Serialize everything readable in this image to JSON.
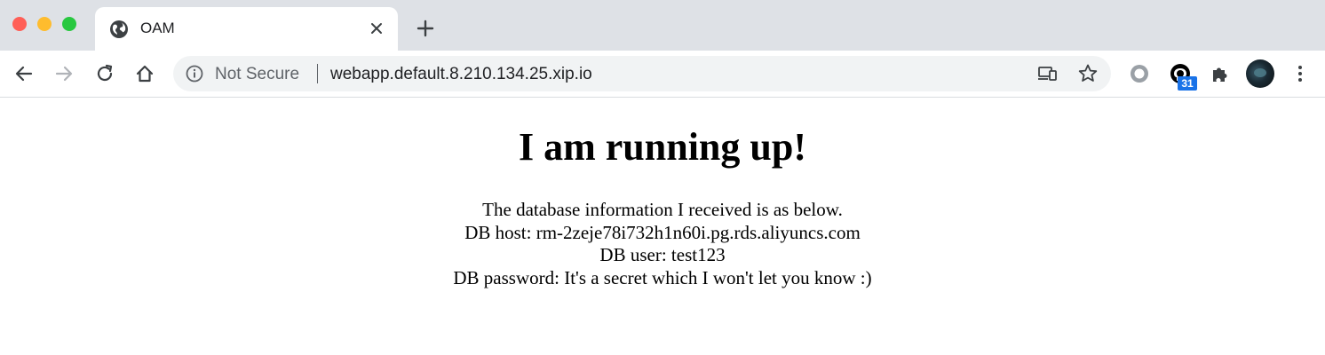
{
  "window": {
    "traffic_lights": [
      "close",
      "minimize",
      "maximize"
    ]
  },
  "tabs": [
    {
      "title": "OAM",
      "icon": "globe-icon",
      "active": true
    }
  ],
  "toolbar": {
    "security_label": "Not Secure",
    "url": "webapp.default.8.210.134.25.xip.io",
    "extension_badge": "31"
  },
  "page": {
    "heading": "I am running up!",
    "lines": [
      "The database information I received is as below.",
      "DB host: rm-2zeje78i732h1n60i.pg.rds.aliyuncs.com",
      "DB user: test123",
      "DB password: It's a secret which I won't let you know :)"
    ]
  },
  "colors": {
    "tabstrip_bg": "#dee1e6",
    "omnibox_bg": "#f1f3f4",
    "badge_bg": "#1a73e8"
  }
}
